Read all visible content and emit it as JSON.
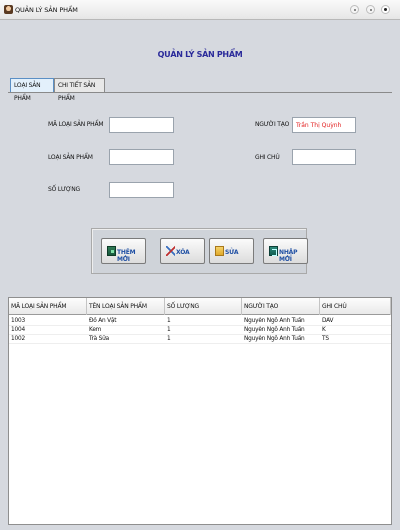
{
  "window": {
    "title": "QUẢN LÝ SẢN PHẨM"
  },
  "heading": "QUẢN LÝ SẢN PHẨM",
  "tabs": [
    {
      "label": "LOẠI SẢN PHẨM",
      "active": true
    },
    {
      "label": "CHI TIẾT SẢN PHẨM",
      "active": false
    }
  ],
  "form": {
    "ma_loai_label": "MÃ LOẠI SẢN PHẨM",
    "ma_loai_value": "",
    "loai_label": "LOẠI SẢN PHẨM",
    "loai_value": "",
    "so_luong_label": "SỐ LƯỢNG",
    "so_luong_value": "",
    "nguoi_tao_label": "NGƯỜI TẠO",
    "nguoi_tao_value": "Trần Thị Quỳnh",
    "ghi_chu_label": "GHI CHÚ",
    "ghi_chu_value": ""
  },
  "buttons": {
    "add": "THÊM MỚI",
    "delete": "XÓA",
    "edit": "SỬA",
    "reset": "NHẬP MỚI"
  },
  "table": {
    "columns": [
      "MÃ LOẠI SẢN PHẨM",
      "TÊN LOẠI SẢN PHẨM",
      "SỐ LƯỢNG",
      "NGƯỜI TẠO",
      "GHI CHÚ"
    ],
    "rows": [
      [
        "1003",
        "Đồ Ăn Vặt",
        "1",
        "Nguyễn Ngô Anh Tuấn",
        "DAV"
      ],
      [
        "1004",
        "Kem",
        "1",
        "Nguyễn Ngô Anh Tuấn",
        "K"
      ],
      [
        "1002",
        "Trà Sữa",
        "1",
        "Nguyễn Ngô Anh Tuấn",
        "TS"
      ]
    ]
  },
  "colors": {
    "heading": "#2a2a9a",
    "creator_text": "#e22020",
    "button_text": "#1f4fa3"
  },
  "icons": [
    "app-icon",
    "minimize-icon",
    "maximize-icon",
    "close-icon",
    "add-icon",
    "delete-icon",
    "edit-icon",
    "reset-icon"
  ]
}
